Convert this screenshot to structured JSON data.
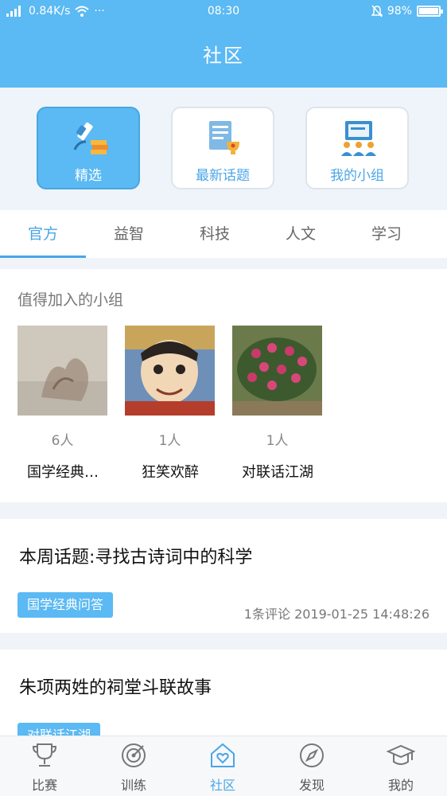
{
  "status_bar": {
    "network": "0.84K/s",
    "more": "···",
    "time": "08:30",
    "battery": "98%"
  },
  "header": {
    "title": "社区"
  },
  "quick_entries": [
    {
      "label": "精选",
      "icon": "microscope-books-icon",
      "active": true
    },
    {
      "label": "最新话题",
      "icon": "document-trophy-icon",
      "active": false
    },
    {
      "label": "我的小组",
      "icon": "group-board-icon",
      "active": false
    }
  ],
  "tabs": [
    {
      "label": "官方",
      "active": true
    },
    {
      "label": "益智",
      "active": false
    },
    {
      "label": "科技",
      "active": false
    },
    {
      "label": "人文",
      "active": false
    },
    {
      "label": "学习",
      "active": false
    }
  ],
  "groups_section": {
    "title": "值得加入的小组",
    "items": [
      {
        "count": "6人",
        "name": "国学经典…"
      },
      {
        "count": "1人",
        "name": "狂笑欢醉"
      },
      {
        "count": "1人",
        "name": "对联话江湖"
      }
    ]
  },
  "topics": [
    {
      "title": "本周话题:寻找古诗词中的科学",
      "tag": "国学经典问答",
      "meta": "1条评论   2019-01-25 14:48:26"
    },
    {
      "title": "朱项两姓的祠堂斗联故事",
      "tag": "对联话江湖"
    }
  ],
  "bottom_nav": [
    {
      "label": "比赛",
      "icon": "trophy-icon",
      "active": false
    },
    {
      "label": "训练",
      "icon": "target-icon",
      "active": false
    },
    {
      "label": "社区",
      "icon": "home-heart-icon",
      "active": true
    },
    {
      "label": "发现",
      "icon": "compass-icon",
      "active": false
    },
    {
      "label": "我的",
      "icon": "graduation-cap-icon",
      "active": false
    }
  ],
  "colors": {
    "primary": "#5bb9f3",
    "accent_text": "#4aa6e8"
  }
}
